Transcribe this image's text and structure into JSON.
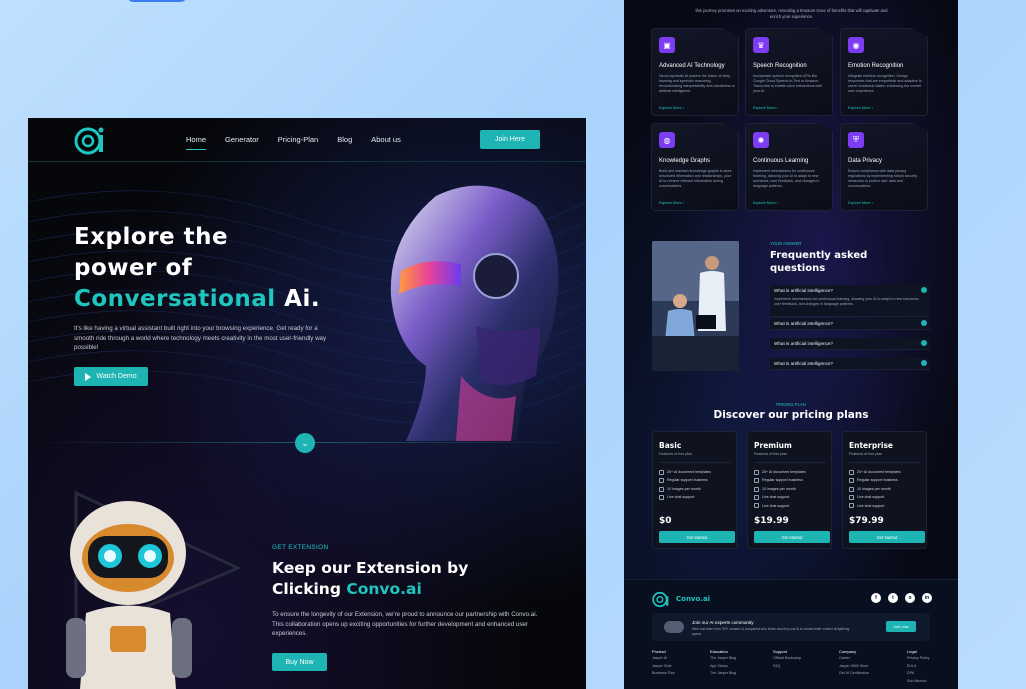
{
  "left": {
    "nav": {
      "links": [
        "Home",
        "Generator",
        "Pricing-Plan",
        "Blog",
        "About us"
      ],
      "join": "Join Here"
    },
    "hero": {
      "line1": "Explore the",
      "line2": "power of",
      "accent": "Conversational",
      "after": " Ai.",
      "desc": "It's like having a virtual assistant built right into your browsing experience. Get ready for a smooth ride through a world where technology meets creativity in the most user-friendly way possible!",
      "watch": "Watch Demo"
    },
    "extension": {
      "label": "GET EXTENSION",
      "title1": "Keep our Extension by",
      "title2": "Clicking",
      "accent": " Convo.ai",
      "desc": "To ensure the longevity of our Extension, we're proud to announce our partnership with Convo.ai. This collaboration opens up exciting opportunities for further development and enhanced user experiences.",
      "buy": "Buy Now"
    }
  },
  "right": {
    "intro": "this journey promises an exciting adventure, revealing a treasure trove of benefits that will captivate and enrich your experience.",
    "features": [
      {
        "title": "Advanced AI Technology",
        "desc": "Neuro-symbolic AI powers the fusion of deep learning and symbolic reasoning, revolutionizing interpretability and robustness in artificial intelligence.",
        "more": "Explore More  ›"
      },
      {
        "title": "Speech Recognition",
        "desc": "Incorporate speech recognition APIs like Google Cloud Speech-to-Text or Amazon Transcribe to enable voice interactions with your AI.",
        "more": "Explore More  ›"
      },
      {
        "title": "Emotion Recognition",
        "desc": "Integrate emotion recognition. Design responses that are empathetic and adaptive to users' emotional states, enhancing the overall user experience.",
        "more": "Explore More  ›"
      },
      {
        "title": "Knowledge Graphs",
        "desc": "Build and maintain knowledge graphs to store structured information and relationships. your AI to retrieve relevant information during conversations.",
        "more": "Explore More  ›"
      },
      {
        "title": "Continuous Learning",
        "desc": "Implement mechanisms for continuous learning, allowing your AI to adapt to new scenarios, user feedback, and changes in language patterns.",
        "more": "Explore More  ›"
      },
      {
        "title": "Data Privacy",
        "desc": "Ensure compliance with data privacy regulations by implementing robust security measures to protect user data and conversations.",
        "more": "Explore More  ›"
      }
    ],
    "faq": {
      "label": "YOUR ANSWER",
      "title": "Frequently asked questions",
      "items": [
        {
          "q": "What is artificial intelligence?",
          "a": "Implement mechanisms for continuous learning, allowing your AI to adapt to new scenarios, user feedback, and changes in language patterns."
        },
        {
          "q": "What is artificial intelligence?",
          "a": ""
        },
        {
          "q": "What is artificial intelligence?",
          "a": ""
        },
        {
          "q": "What is artificial intelligence?",
          "a": ""
        }
      ]
    },
    "pricing": {
      "label": "PRICING PLAN",
      "title": "Discover our pricing plans",
      "plans": [
        {
          "name": "Basic",
          "sub": "Features of free plan",
          "features": [
            "20+ AI document templates",
            "Regular support business",
            "10 images per month",
            "Live chat support"
          ],
          "price": "$0",
          "button": "Get started"
        },
        {
          "name": "Premium",
          "sub": "Features of free plan",
          "features": [
            "20+ AI document templates",
            "Regular support business",
            "10 images per month",
            "Live chat support",
            "Live chat support"
          ],
          "price": "$19.99",
          "button": "Get started"
        },
        {
          "name": "Enterprise",
          "sub": "Features of free plan",
          "features": [
            "20+ AI document templates",
            "Regular support business",
            "10 images per month",
            "Live chat support",
            "Live chat support"
          ],
          "price": "$79.99",
          "button": "Get started"
        }
      ]
    },
    "footer": {
      "brand": "Convo.ai",
      "socials": [
        "f",
        "t",
        "o",
        "in"
      ],
      "community_title": "Join our AI experts community",
      "community_desc": "Meet and learn from 700+ creators & companies who share how they use AI to create better content at lightning speed.",
      "join": "Join now",
      "columns": [
        {
          "head": "Product",
          "items": [
            "Jasper AI",
            "Jasper Chat",
            "Business Plan"
          ]
        },
        {
          "head": "Education",
          "items": [
            "The Jasper Blog",
            "App Status",
            "The Jasper Blog"
          ]
        },
        {
          "head": "Support",
          "items": [
            "Official Bootcamp",
            "FAQ",
            ""
          ]
        },
        {
          "head": "Company",
          "items": [
            "Career",
            "Jasper 0800 Store",
            "Get AI Certification"
          ]
        },
        {
          "head": "Legal",
          "items": [
            "Privacy Policy",
            "EULA",
            "DPA",
            "Sub Mission"
          ]
        }
      ]
    }
  },
  "colors": {
    "accent": "#1ec6c0",
    "button": "#1eb4b4",
    "icon": "#7b3cf2",
    "bg": "#06070b"
  }
}
